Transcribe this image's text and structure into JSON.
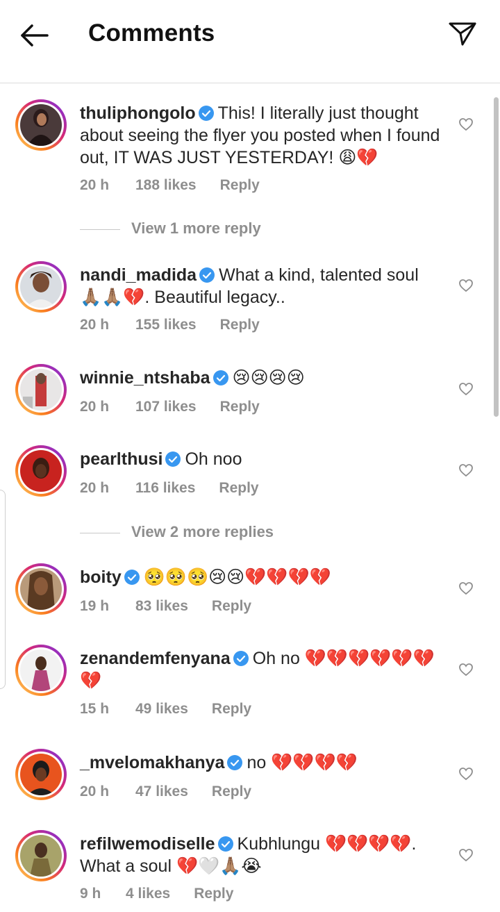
{
  "header": {
    "title": "Comments",
    "back_icon": "arrow-left-icon",
    "send_icon": "paper-plane-icon"
  },
  "colors": {
    "text": "#262626",
    "secondary": "#8e8e8e",
    "verified": "#3897f0",
    "divider": "#dbdbdb"
  },
  "comments": [
    {
      "username": "thuliphongolo",
      "text": "This! I literally just thought about seeing the flyer you posted when I found out, IT WAS JUST YESTERDAY! 😩💔",
      "time": "20 h",
      "likes": "188 likes",
      "reply": "Reply",
      "view_more": "View 1 more reply"
    },
    {
      "username": "nandi_madida",
      "text": "What a kind, talented soul 🙏🏽🙏🏽💔. Beautiful legacy..",
      "time": "20 h",
      "likes": "155 likes",
      "reply": "Reply"
    },
    {
      "username": "winnie_ntshaba",
      "text": "😢😢😢😢",
      "time": "20 h",
      "likes": "107 likes",
      "reply": "Reply"
    },
    {
      "username": "pearlthusi",
      "text": "Oh noo",
      "time": "20 h",
      "likes": "116 likes",
      "reply": "Reply",
      "view_more": "View 2 more replies"
    },
    {
      "username": "boity",
      "text": "🥺🥺🥺😢😢💔💔💔💔",
      "time": "19 h",
      "likes": "83 likes",
      "reply": "Reply"
    },
    {
      "username": "zenandemfenyana",
      "text": "Oh no 💔💔💔💔💔💔💔",
      "time": "15 h",
      "likes": "49 likes",
      "reply": "Reply"
    },
    {
      "username": "_mvelomakhanya",
      "text": "no 💔💔💔💔",
      "time": "20 h",
      "likes": "47 likes",
      "reply": "Reply"
    },
    {
      "username": "refilwemodiselle",
      "text": "Kubhlungu 💔💔💔💔. What a soul 💔🤍🙏🏽😭",
      "time": "9 h",
      "likes": "4 likes",
      "reply": "Reply"
    }
  ]
}
